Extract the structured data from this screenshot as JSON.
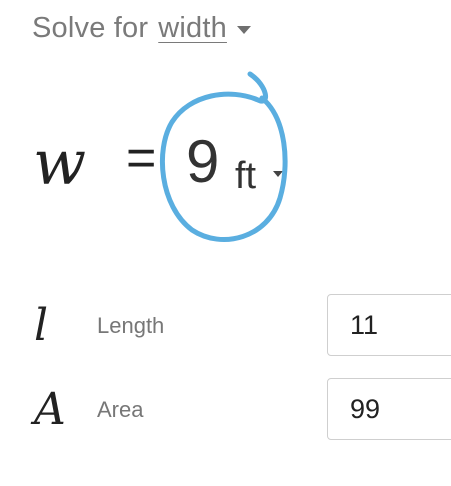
{
  "solver": {
    "prefix": "Solve for",
    "variable": "width"
  },
  "result": {
    "symbol": "w",
    "equals": "=",
    "value": "9",
    "unit": "ft"
  },
  "inputs": [
    {
      "symbol": "l",
      "label": "Length",
      "value": "11"
    },
    {
      "symbol": "A",
      "label": "Area",
      "value": "99"
    }
  ],
  "colors": {
    "annotation": "#5aaee0",
    "input_border": "#cfcfcf",
    "muted_text": "#777777"
  }
}
